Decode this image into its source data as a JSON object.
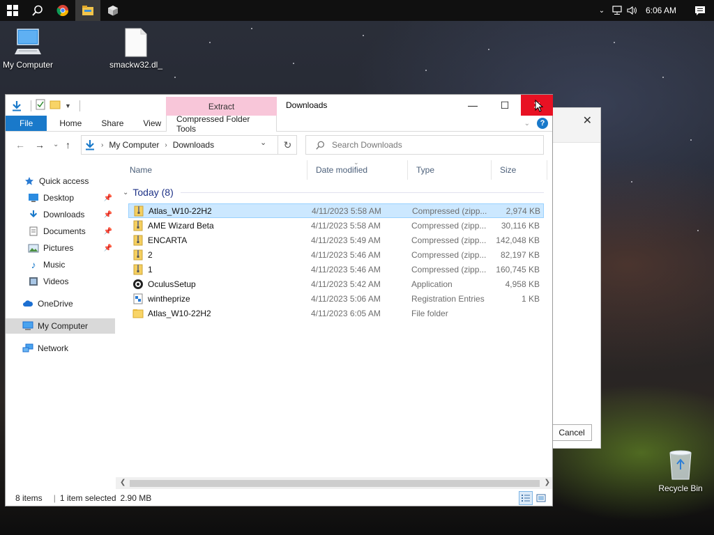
{
  "taskbar": {
    "clock": "6:06 AM",
    "apps": [
      "start-icon",
      "search-icon",
      "chrome-icon",
      "file-explorer-icon",
      "package-icon"
    ]
  },
  "desktop": {
    "icons": [
      {
        "label": "My Computer",
        "icon": "computer-icon"
      },
      {
        "label": "smackw32.dl_",
        "icon": "file-icon"
      },
      {
        "label": "Recycle Bin",
        "icon": "recycle-bin-icon"
      }
    ]
  },
  "background_dialog": {
    "cancel_label": "Cancel"
  },
  "explorer": {
    "title": "Downloads",
    "context_tab_group": "Extract",
    "ribbon_tabs": [
      "File",
      "Home",
      "Share",
      "View",
      "Compressed Folder Tools"
    ],
    "address": {
      "crumbs": [
        "My Computer",
        "Downloads"
      ]
    },
    "search": {
      "placeholder": "Search Downloads"
    },
    "nav_pane": [
      {
        "label": "Quick access",
        "icon": "star-icon"
      },
      {
        "label": "Desktop",
        "icon": "desktop-icon",
        "pinned": true
      },
      {
        "label": "Downloads",
        "icon": "download-arrow-icon",
        "pinned": true
      },
      {
        "label": "Documents",
        "icon": "documents-icon",
        "pinned": true
      },
      {
        "label": "Pictures",
        "icon": "pictures-icon",
        "pinned": true
      },
      {
        "label": "Music",
        "icon": "music-icon"
      },
      {
        "label": "Videos",
        "icon": "videos-icon"
      },
      {
        "label": "OneDrive",
        "icon": "cloud-icon"
      },
      {
        "label": "My Computer",
        "icon": "computer-icon",
        "selected": true
      },
      {
        "label": "Network",
        "icon": "network-icon"
      }
    ],
    "columns": [
      "Name",
      "Date modified",
      "Type",
      "Size"
    ],
    "group_label": "Today (8)",
    "files": [
      {
        "name": "Atlas_W10-22H2",
        "date": "4/11/2023 5:58 AM",
        "type": "Compressed (zipp...",
        "size": "2,974 KB",
        "icon": "zip-folder-icon",
        "selected": true
      },
      {
        "name": "AME Wizard Beta",
        "date": "4/11/2023 5:58 AM",
        "type": "Compressed (zipp...",
        "size": "30,116 KB",
        "icon": "zip-folder-icon"
      },
      {
        "name": "ENCARTA",
        "date": "4/11/2023 5:49 AM",
        "type": "Compressed (zipp...",
        "size": "142,048 KB",
        "icon": "zip-folder-icon"
      },
      {
        "name": "2",
        "date": "4/11/2023 5:46 AM",
        "type": "Compressed (zipp...",
        "size": "82,197 KB",
        "icon": "zip-folder-icon"
      },
      {
        "name": "1",
        "date": "4/11/2023 5:46 AM",
        "type": "Compressed (zipp...",
        "size": "160,745 KB",
        "icon": "zip-folder-icon"
      },
      {
        "name": "OculusSetup",
        "date": "4/11/2023 5:42 AM",
        "type": "Application",
        "size": "4,958 KB",
        "icon": "oculus-app-icon"
      },
      {
        "name": "wintheprize",
        "date": "4/11/2023 5:06 AM",
        "type": "Registration Entries",
        "size": "1 KB",
        "icon": "registry-file-icon"
      },
      {
        "name": "Atlas_W10-22H2",
        "date": "4/11/2023 6:05 AM",
        "type": "File folder",
        "size": "",
        "icon": "folder-icon"
      }
    ],
    "status": {
      "item_count": "8 items",
      "selection": "1 item selected",
      "selection_size": "2.90 MB"
    }
  }
}
